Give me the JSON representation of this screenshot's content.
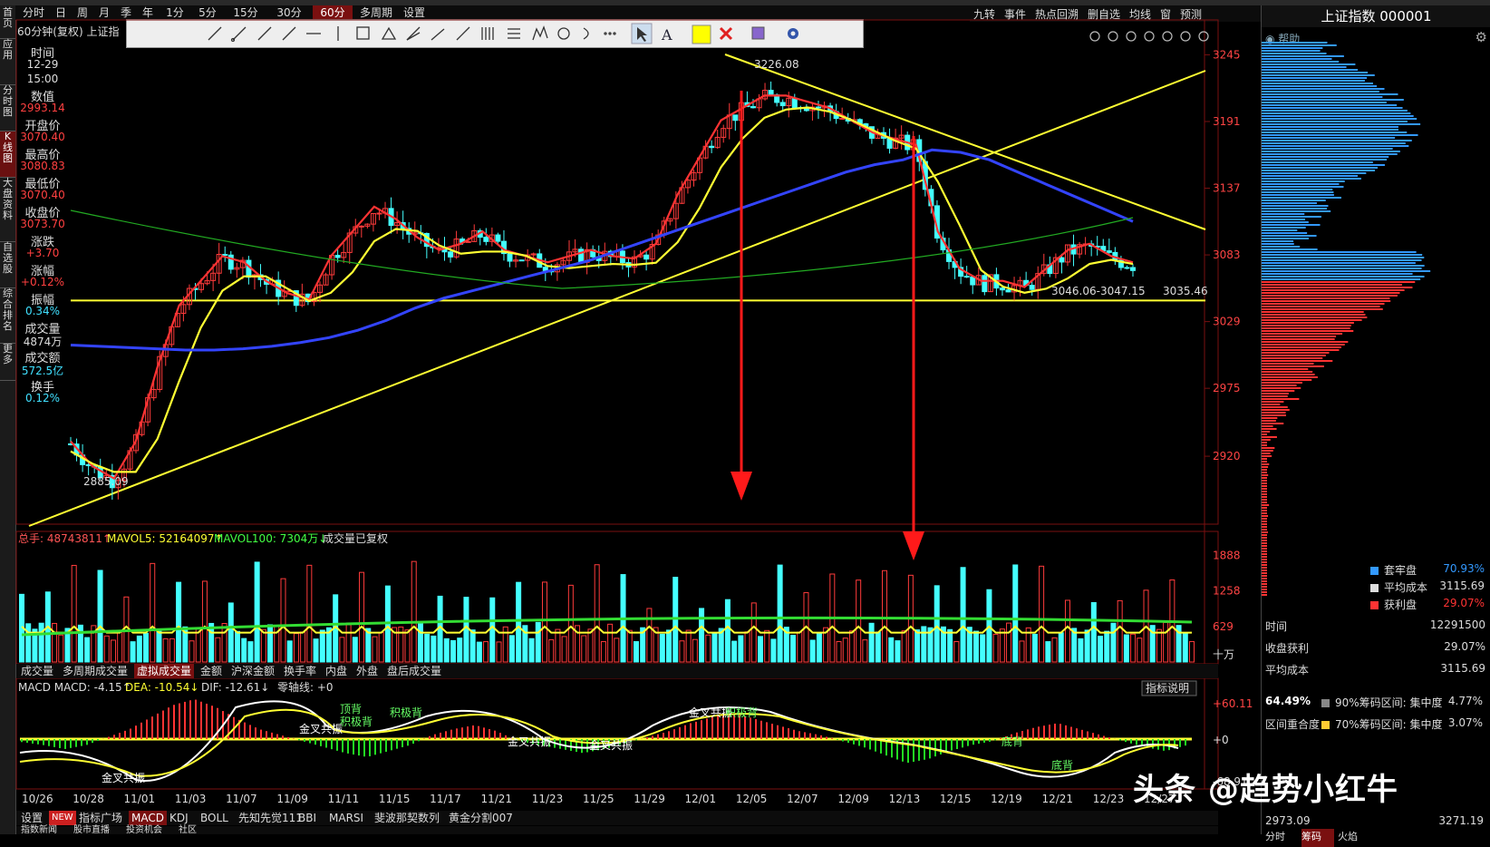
{
  "app": {
    "title": "上证指数 000001"
  },
  "period_tabs": [
    "分时",
    "日",
    "周",
    "月",
    "季",
    "年",
    "1分",
    "5分",
    "15分",
    "30分",
    "60分",
    "多周期",
    "设置"
  ],
  "period_active": "60分",
  "right_tabs": [
    "九转",
    "事件",
    "热点回溯",
    "删自选",
    "均线",
    "窗",
    "预测"
  ],
  "chart_title": "60分钟(复权) 上证指",
  "left_tabs": [
    "首页",
    "应用",
    "分时图",
    "K线图",
    "大盘资料",
    "自选股",
    "综合排名",
    "更多"
  ],
  "left_active": "K线图",
  "data_window": {
    "items": [
      {
        "label": "时间",
        "values": [
          "12-29",
          "15:00"
        ],
        "color": "#dddddd"
      },
      {
        "label": "数值",
        "values": [
          "2993.14"
        ],
        "color": "#ff4040"
      },
      {
        "label": "开盘价",
        "values": [
          "3070.40"
        ],
        "color": "#ff4040"
      },
      {
        "label": "最高价",
        "values": [
          "3080.83"
        ],
        "color": "#ff4040"
      },
      {
        "label": "最低价",
        "values": [
          "3070.40"
        ],
        "color": "#ff4040"
      },
      {
        "label": "收盘价",
        "values": [
          "3073.70"
        ],
        "color": "#ff4040"
      },
      {
        "label": "涨跌",
        "values": [
          "+3.70"
        ],
        "color": "#ff4040"
      },
      {
        "label": "涨幅",
        "values": [
          "+0.12%"
        ],
        "color": "#ff4040"
      },
      {
        "label": "振幅",
        "values": [
          "0.34%"
        ],
        "color": "#40e0ff"
      },
      {
        "label": "成交量",
        "values": [
          "4874万"
        ],
        "color": "#dddddd"
      },
      {
        "label": "成交额",
        "values": [
          "572.5亿"
        ],
        "color": "#40e0ff"
      },
      {
        "label": "换手",
        "values": [
          "0.12%"
        ],
        "color": "#40e0ff"
      }
    ]
  },
  "price_axis": {
    "ticks": [
      "3245",
      "3191",
      "3137",
      "3083",
      "3029",
      "2975",
      "2920"
    ]
  },
  "annotations": {
    "high": "3226.08",
    "low": "2885.09",
    "level": "3046.06-3047.15",
    "level_right": "3035.46"
  },
  "volume_header": {
    "total": "总手: 48743811↑",
    "mavol5": "MAVOL5: 52164097↑",
    "mavol100": "MAVOL100: 7304万↓",
    "note": "成交量已复权"
  },
  "volume_axis": {
    "ticks": [
      "1888",
      "1258",
      "629",
      "十万"
    ]
  },
  "volume_tabs": [
    "成交量",
    "多周期成交量",
    "虚拟成交量",
    "金额",
    "沪深金额",
    "换手率",
    "内盘",
    "外盘",
    "盘后成交量"
  ],
  "volume_active": "虚拟成交量",
  "macd_header": {
    "macd": "MACD MACD: -4.15↑",
    "dea": "DEA: -10.54↓",
    "dif": "DIF: -12.61↓",
    "zero": "零轴线: +0"
  },
  "macd_help": "指标说明",
  "macd_axis": {
    "ticks": [
      "+60.11",
      "+0",
      "-68.91"
    ]
  },
  "macd_labels": [
    "金叉共振",
    "金叉共振",
    "金叉共振",
    "金叉共振",
    "顶背",
    "积极背",
    "积极背",
    "金叉共振",
    "积极背",
    "底背",
    "底背"
  ],
  "date_axis": [
    "10/26",
    "10/28",
    "11/01",
    "11/03",
    "11/07",
    "11/09",
    "11/11",
    "11/15",
    "11/17",
    "11/21",
    "11/23",
    "11/25",
    "11/29",
    "12/01",
    "12/05",
    "12/07",
    "12/09",
    "12/13",
    "12/15",
    "12/19",
    "12/21",
    "12/23",
    "12/27"
  ],
  "indicator_tabs": [
    "设置",
    "指标广场",
    "MACD",
    "KDJ",
    "BOLL",
    "先知先觉111",
    "BBI",
    "MARSI",
    "斐波那契数列",
    "黄金分割007"
  ],
  "indicator_active": "MACD",
  "indicator_new_badge": "NEW",
  "bottom_tabs": [
    "指数新闻",
    "股市直播",
    "投资机会",
    "社区"
  ],
  "right_panel": {
    "help": "帮助",
    "legend": [
      {
        "label": "套牢盘",
        "value": "70.93%",
        "color": "#3399ff"
      },
      {
        "label": "平均成本",
        "value": "3115.69",
        "color": "#dddddd"
      },
      {
        "label": "获利盘",
        "value": "29.07%",
        "color": "#ff3333"
      }
    ],
    "stats": [
      {
        "label": "时间",
        "value": "12291500"
      },
      {
        "label": "收盘获利",
        "value": "29.07%"
      },
      {
        "label": "平均成本",
        "value": "3115.69"
      }
    ],
    "concentration": {
      "main": "64.49%",
      "r90": "90%筹码区间: 集中度",
      "r90v": "4.77%",
      "r70": "70%筹码区间: 集中度",
      "r70v": "3.07%",
      "overlap": "区间重合度"
    },
    "range": {
      "low": "2973.09",
      "high": "3271.19"
    },
    "bottom_tabs": [
      "分时",
      "筹码",
      "火焰"
    ]
  },
  "watermark": "头条 @趋势小红牛",
  "chart_data": {
    "type": "candlestick",
    "title": "上证指数 000001 60分钟",
    "ylim": [
      2865,
      3260
    ],
    "yticks": [
      3245,
      3191,
      3137,
      3083,
      3029,
      2975,
      2920
    ],
    "ma5_close_approx": [
      2930,
      2910,
      2900,
      2930,
      2990,
      3040,
      3060,
      3080,
      3075,
      3060,
      3050,
      3045,
      3080,
      3100,
      3120,
      3110,
      3095,
      3085,
      3090,
      3100,
      3085,
      3080,
      3075,
      3080,
      3085,
      3080,
      3078,
      3090,
      3130,
      3160,
      3190,
      3200,
      3210,
      3210,
      3205,
      3200,
      3190,
      3180,
      3175,
      3170,
      3100,
      3070,
      3060,
      3060,
      3055,
      3070,
      3085,
      3090,
      3080,
      3075
    ],
    "ma60_approx": [
      3010,
      3009,
      3008,
      3007,
      3006,
      3006,
      3007,
      3009,
      3012,
      3016,
      3022,
      3030,
      3040,
      3048,
      3054,
      3060,
      3066,
      3072,
      3078,
      3086,
      3094,
      3102,
      3110,
      3118,
      3126,
      3134,
      3142,
      3150,
      3156,
      3160,
      3168,
      3166,
      3160,
      3150,
      3140,
      3130,
      3120,
      3110
    ],
    "support_level": 3046.06,
    "high": 3226.08,
    "low": 2885.09,
    "volume_ticks": [
      1888,
      1258,
      629
    ],
    "macd_ticks": [
      60.11,
      0,
      -68.91
    ]
  }
}
